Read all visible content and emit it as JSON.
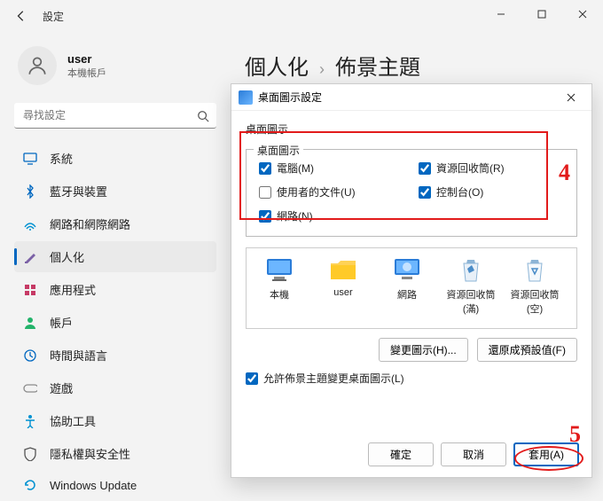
{
  "window": {
    "title": "設定",
    "user": {
      "name": "user",
      "account_type": "本機帳戶"
    },
    "search_placeholder": "尋找設定",
    "nav": [
      {
        "id": "system",
        "label": "系統",
        "icon_color": "#0067c0"
      },
      {
        "id": "bluetooth",
        "label": "藍牙與裝置",
        "icon_color": "#0067c0"
      },
      {
        "id": "network",
        "label": "網路和網際網路",
        "icon_color": "#0091d1"
      },
      {
        "id": "personalize",
        "label": "個人化",
        "icon_color": "#7b61a6",
        "active": true
      },
      {
        "id": "apps",
        "label": "應用程式",
        "icon_color": "#c63a65"
      },
      {
        "id": "accounts",
        "label": "帳戶",
        "icon_color": "#23b36a"
      },
      {
        "id": "time-lang",
        "label": "時間與語言",
        "icon_color": "#0067c0"
      },
      {
        "id": "gaming",
        "label": "遊戲",
        "icon_color": "#8a8a8a"
      },
      {
        "id": "accessibility",
        "label": "協助工具",
        "icon_color": "#0091d1"
      },
      {
        "id": "privacy",
        "label": "隱私權與安全性",
        "icon_color": "#555"
      },
      {
        "id": "update",
        "label": "Windows Update",
        "icon_color": "#0091d1"
      }
    ],
    "breadcrumb": {
      "parent": "個人化",
      "current": "佈景主題"
    }
  },
  "dialog": {
    "title": "桌面圖示設定",
    "tab_label": "桌面圖示",
    "group_title": "桌面圖示",
    "checkboxes": {
      "computer": {
        "label": "電腦(M)",
        "checked": true
      },
      "recycle": {
        "label": "資源回收筒(R)",
        "checked": true
      },
      "userdocs": {
        "label": "使用者的文件(U)",
        "checked": false
      },
      "control": {
        "label": "控制台(O)",
        "checked": true
      },
      "network": {
        "label": "網路(N)",
        "checked": true
      }
    },
    "preview_icons": [
      {
        "id": "this-pc",
        "label": "本機"
      },
      {
        "id": "user-folder",
        "label": "user"
      },
      {
        "id": "network",
        "label": "網路"
      },
      {
        "id": "recycle-full",
        "label": "資源回收筒 (滿)"
      },
      {
        "id": "recycle-empty",
        "label": "資源回收筒 (空)"
      }
    ],
    "buttons": {
      "change_icon": "變更圖示(H)...",
      "restore_default": "還原成預設值(F)"
    },
    "allow_themes_label": "允許佈景主題變更桌面圖示(L)",
    "allow_themes_checked": true,
    "footer": {
      "ok": "確定",
      "cancel": "取消",
      "apply": "套用(A)"
    }
  },
  "annotations": {
    "num4": "4",
    "num5": "5"
  }
}
